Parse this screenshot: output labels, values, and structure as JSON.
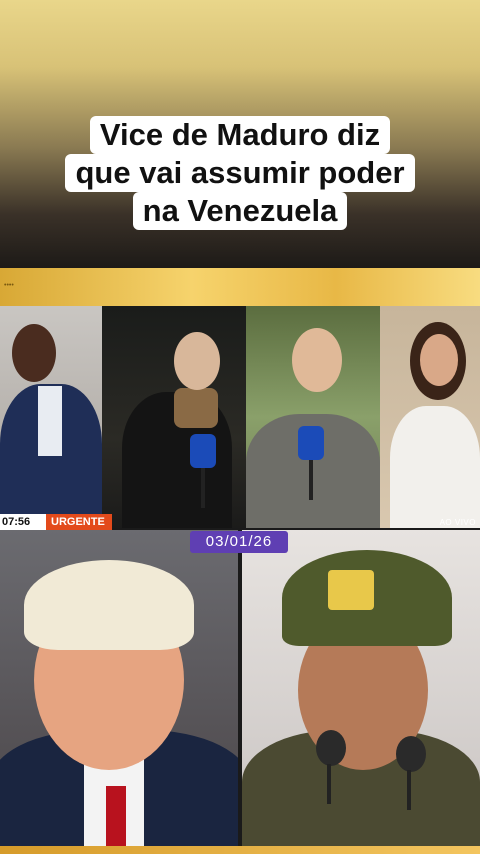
{
  "headline": {
    "line1": "Vice de Maduro diz",
    "line2": "que vai assumir poder",
    "line3": "na Venezuela"
  },
  "broadcast": {
    "time": "07:56",
    "tag": "URGENTE",
    "live": "AO VIVO",
    "corner_text": "••••"
  },
  "date_badge": "03/01/26",
  "colors": {
    "accent_gold": "#f3c55f",
    "urgent_orange": "#e34a1b",
    "date_purple": "#5f3fb3"
  }
}
